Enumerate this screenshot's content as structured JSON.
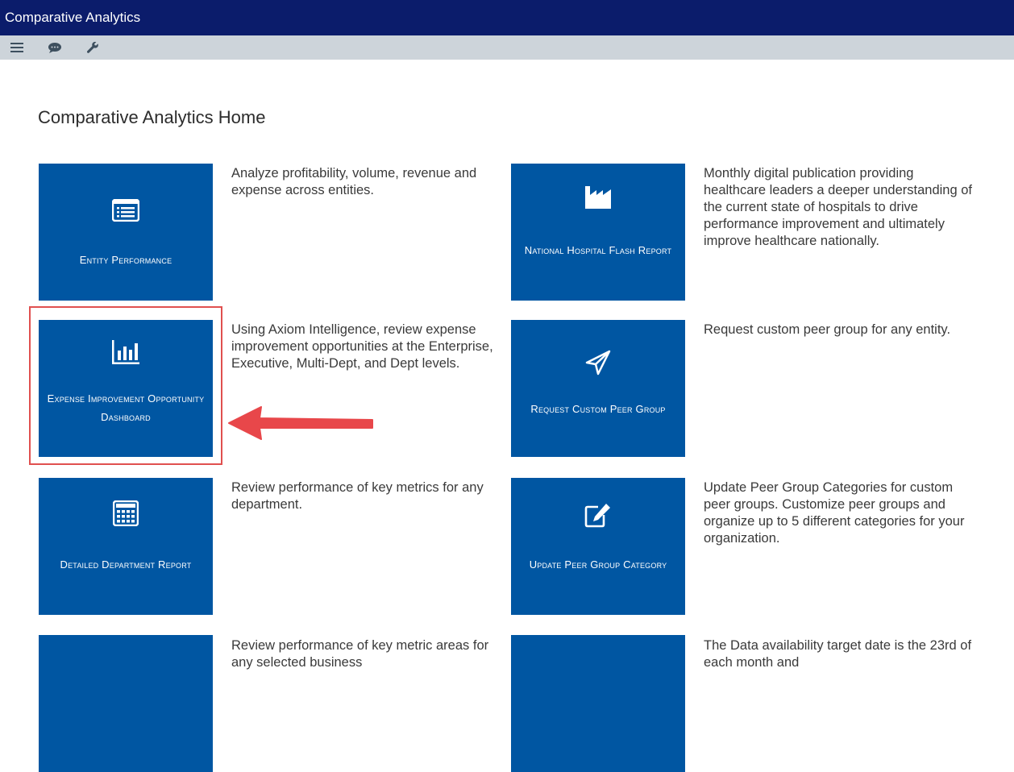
{
  "window": {
    "title": "Comparative Analytics"
  },
  "toolbar": {
    "icons": [
      "menu-icon",
      "chat-icon",
      "wrench-icon"
    ]
  },
  "page": {
    "title": "Comparative Analytics Home"
  },
  "tiles": [
    {
      "label": "Entity Performance",
      "description": "Analyze profitability, volume, revenue and expense across entities.",
      "icon": "list-icon"
    },
    {
      "label": "National Hospital Flash Report",
      "description": "Monthly digital publication providing healthcare leaders a deeper understanding of the current state of hospitals to drive performance improvement and ultimately improve healthcare nationally.",
      "icon": "factory-icon"
    },
    {
      "label": "Expense Improvement Opportunity Dashboard",
      "description": "Using Axiom Intelligence, review expense improvement opportunities at the Enterprise, Executive, Multi-Dept, and Dept levels.",
      "icon": "bar-chart-icon"
    },
    {
      "label": "Request Custom Peer Group",
      "description": "Request custom peer group for any entity.",
      "icon": "paper-plane-icon"
    },
    {
      "label": "Detailed Department Report",
      "description": "Review performance of key metrics for any department.",
      "icon": "calculator-icon"
    },
    {
      "label": "Update Peer Group Category",
      "description": "Update Peer Group Categories for custom peer groups. Customize peer groups and organize up to 5 different categories for your organization.",
      "icon": "edit-icon"
    },
    {
      "label": "",
      "description": "Review performance of key metric areas for any selected business",
      "icon": ""
    },
    {
      "label": "",
      "description": "The Data availability target date is the 23rd of each month and",
      "icon": ""
    }
  ],
  "colors": {
    "titlebar": "#0b1c6b",
    "toolbar": "#cdd4da",
    "tile": "#0056a2",
    "highlight": "#e0504f",
    "arrow": "#e8474a"
  }
}
